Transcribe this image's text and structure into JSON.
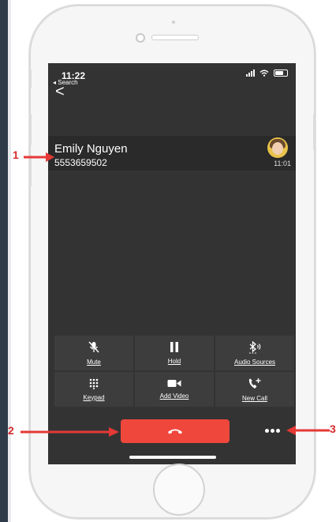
{
  "status_bar": {
    "time": "11:22",
    "back_app": "◂ Search"
  },
  "caller": {
    "name": "Emily Nguyen",
    "number": "5553659502",
    "duration": "11:01"
  },
  "controls": {
    "mute": "Mute",
    "hold": "Hold",
    "audio_sources": "Audio Sources",
    "keypad": "Keypad",
    "add_video": "Add Video",
    "new_call": "New Call"
  },
  "callouts": {
    "one": "1",
    "two": "2",
    "three": "3"
  },
  "colors": {
    "end_call": "#f0473d",
    "screen_bg": "#333333",
    "callout": "#e53935"
  },
  "icons": [
    "back-chevron-icon",
    "mic-off-icon",
    "pause-icon",
    "bluetooth-icon",
    "keypad-icon",
    "video-camera-icon",
    "add-call-icon",
    "hang-up-icon",
    "more-dots-icon"
  ]
}
